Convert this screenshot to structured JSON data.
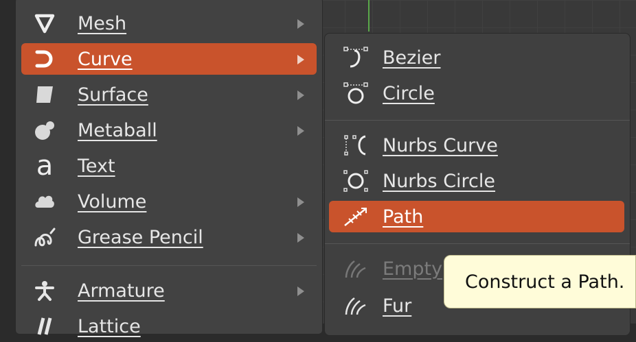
{
  "add_menu": {
    "items": [
      {
        "label": "Mesh",
        "icon": "mesh-icon",
        "submenu": true,
        "active": false
      },
      {
        "label": "Curve",
        "icon": "curve-icon",
        "submenu": true,
        "active": true
      },
      {
        "label": "Surface",
        "icon": "surface-icon",
        "submenu": true,
        "active": false
      },
      {
        "label": "Metaball",
        "icon": "metaball-icon",
        "submenu": true,
        "active": false
      },
      {
        "label": "Text",
        "icon": "text-icon",
        "submenu": false,
        "active": false
      },
      {
        "label": "Volume",
        "icon": "volume-icon",
        "submenu": true,
        "active": false
      },
      {
        "label": "Grease Pencil",
        "icon": "grease-pencil-icon",
        "submenu": true,
        "active": false
      },
      {
        "label": "Armature",
        "icon": "armature-icon",
        "submenu": true,
        "active": false
      },
      {
        "label": "Lattice",
        "icon": "lattice-icon",
        "submenu": false,
        "active": false
      }
    ]
  },
  "curve_submenu": {
    "items": [
      {
        "label": "Bezier",
        "icon": "bezier-icon",
        "state": "normal"
      },
      {
        "label": "Circle",
        "icon": "bezier-circle-icon",
        "state": "normal"
      },
      {
        "label": "Nurbs Curve",
        "icon": "nurbs-curve-icon",
        "state": "normal"
      },
      {
        "label": "Nurbs Circle",
        "icon": "nurbs-circle-icon",
        "state": "normal"
      },
      {
        "label": "Path",
        "icon": "path-icon",
        "state": "active"
      },
      {
        "label": "Empty",
        "icon": "hair-empty-icon",
        "state": "disabled"
      },
      {
        "label": "Fur",
        "icon": "fur-icon",
        "state": "normal"
      }
    ]
  },
  "tooltip": {
    "text": "Construct a Path."
  },
  "colors": {
    "accent": "#c9532c",
    "menu_bg": "#424242",
    "tooltip_bg": "#fffcd9"
  }
}
